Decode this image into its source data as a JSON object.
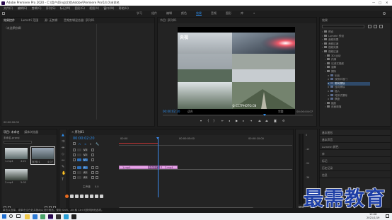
{
  "window": {
    "title": "Adobe Premiere Pro 2020 - C:\\用户\\Ding\\文档\\Adobe\\Premiere Pro\\14.0\\未命名",
    "controls": [
      "—",
      "□",
      "✕"
    ]
  },
  "menu": [
    "文件(F)",
    "编辑(E)",
    "剪辑(C)",
    "序列(S)",
    "标记(M)",
    "图形(G)",
    "视图(V)",
    "窗口(W)",
    "帮助(H)"
  ],
  "workspaces": [
    "学习",
    "组件",
    "编辑",
    "颜色",
    "效果",
    "音频",
    "图形",
    "库"
  ],
  "workspace_active": "效果",
  "source_panel": {
    "tabs": [
      "效果控件",
      "Lumetri 范围",
      "源: 无剪辑",
      "音频剪辑混合器: 序列01"
    ],
    "empty_text": "（未选择剪辑）",
    "footer": "00:00:00:00"
  },
  "program": {
    "tab": "节目: 序列01",
    "overlay_title": "央视",
    "watermark": "© CCTPHOTO.CN",
    "timecode_left": "00:00:02:20",
    "fit": "适合",
    "quality": "完整",
    "timecode_right": "00:00:04:07"
  },
  "effects": {
    "tab": "效果",
    "items": [
      {
        "label": "预设",
        "depth": 0
      },
      {
        "label": "Lumetri 预设",
        "depth": 0
      },
      {
        "label": "音频效果",
        "depth": 0
      },
      {
        "label": "音频过渡",
        "depth": 0
      },
      {
        "label": "视频效果",
        "depth": 0
      },
      {
        "label": "视频过渡",
        "depth": 0
      },
      {
        "label": "3D 运动",
        "depth": 1
      },
      {
        "label": "内滑",
        "depth": 1
      },
      {
        "label": "沉浸式视频",
        "depth": 1
      },
      {
        "label": "溶解",
        "depth": 1
      },
      {
        "label": "擦除",
        "depth": 1
      },
      {
        "label": "划出",
        "depth": 2
      },
      {
        "label": "双侧平推门",
        "depth": 2
      },
      {
        "label": "带状擦除",
        "depth": 2
      },
      {
        "label": "径向擦除",
        "depth": 2
      },
      {
        "label": "插入",
        "depth": 2
      },
      {
        "label": "时钟式擦除",
        "depth": 2
      },
      {
        "label": "棋盘",
        "depth": 2
      },
      {
        "label": "缩放",
        "depth": 1
      },
      {
        "label": "页面剥落",
        "depth": 1
      }
    ],
    "lower_items": [
      "基本图形",
      "基本声音",
      "Lumetri 颜色",
      "库",
      "标记",
      "历史记录",
      "信息"
    ]
  },
  "project": {
    "tabs": [
      "项目: 未命名",
      "媒体浏览器"
    ],
    "project_name": "未命名.prproj",
    "clips": [
      {
        "name": "1.mp4",
        "duration": "4:21"
      },
      {
        "name": "序列01",
        "duration": "4:07"
      },
      {
        "name": "2.mp4",
        "duration": "5:02"
      }
    ]
  },
  "timeline": {
    "tab": "序列01",
    "timecode": "00:00:02:20",
    "ruler": [
      "00:00",
      "00:00:05:00",
      "00:00:10:00"
    ],
    "tracks": [
      "V3",
      "V2",
      "V1",
      "A1",
      "A2",
      "A3"
    ],
    "master": "主声道",
    "master_value": "0.0",
    "clip1": "1.mp4",
    "transition": "交叉溶解",
    "clip2": "2.mp4"
  },
  "audio_meter_labels": [
    "0",
    "-12",
    "-24",
    "-36",
    "-48",
    "dB"
  ],
  "status_bar": "单击以选择，或单击空白处并拖动以进行框选。使用 Shift、Alt 和 Ctrl 可获得其他选项。",
  "watermark_text": "最需教育",
  "taskbar": {
    "time": "10:08",
    "date": "2021/1/19"
  },
  "colors": {
    "accent_blue": "#2d8ceb",
    "clip_pink": "#e7a3e8",
    "playhead": "#3c8bf0",
    "watermark_blue": "#1e3fa6"
  }
}
